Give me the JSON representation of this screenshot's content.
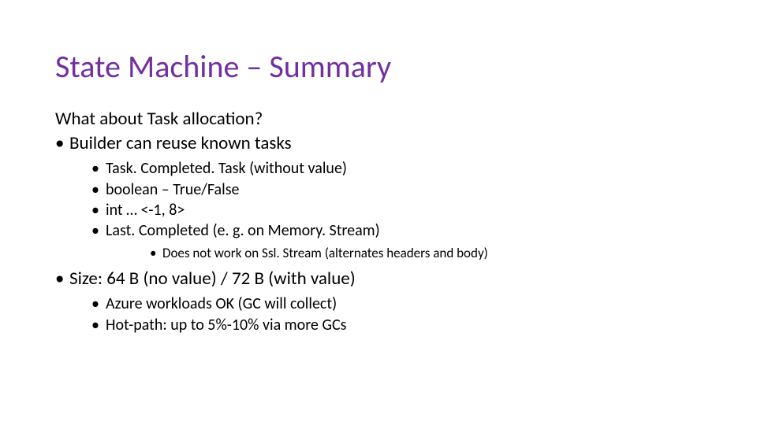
{
  "title": "State Machine – Summary",
  "lead": "What about Task allocation?",
  "b1": "Builder can reuse known tasks",
  "sub": {
    "a": "Task. Completed. Task (without value)",
    "b": "boolean – True/False",
    "c": "int … <-1, 8>",
    "d": "Last. Completed (e. g. on Memory. Stream)"
  },
  "subsub": {
    "a": "Does not work on Ssl. Stream (alternates headers and body)"
  },
  "b2": "Size: 64 B (no value) / 72 B (with value)",
  "sub2": {
    "a": "Azure workloads OK (GC will collect)",
    "b": "Hot-path: up to 5%-10% via more GCs"
  }
}
